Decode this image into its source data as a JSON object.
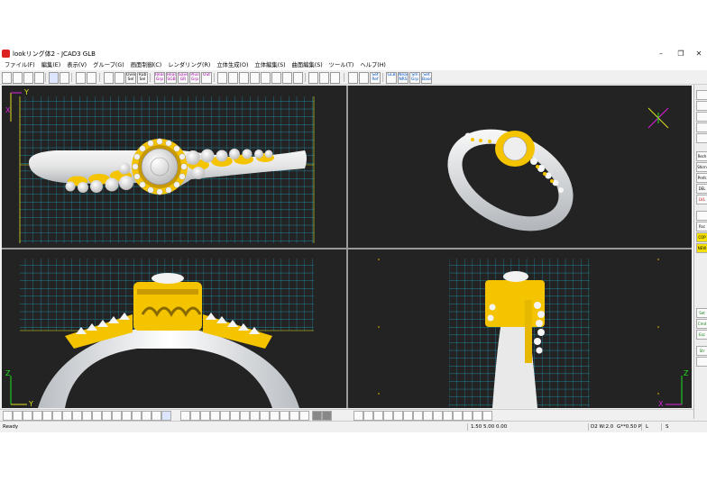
{
  "window": {
    "title": "lookリング体2 - JCAD3 GLB",
    "minimize": "–",
    "maximize": "❐",
    "close": "✕"
  },
  "menu": [
    "ファイル(F)",
    "編集(E)",
    "表示(V)",
    "グループ(G)",
    "画面制御(C)",
    "レンダリング(R)",
    "立体生成(O)",
    "立体編集(S)",
    "曲面編集(S)",
    "ツール(T)",
    "ヘルプ(H)"
  ],
  "toolbar": {
    "labels": [
      "Over Sel",
      "Rub Sel",
      "Read Grp",
      "Read SGB",
      "Save GR",
      "Plus Grp",
      "Out",
      "Set Ref",
      "GLB",
      "Near NRS",
      "Sm Grp",
      "Set Base"
    ]
  },
  "sidebar": {
    "labels": [
      "Rech",
      "Stkrn",
      "Prefs",
      "DEL",
      "LVL",
      "Rsc",
      "COP",
      "NEW",
      "Set Ref",
      "Cmd Strt",
      "Exc Spl",
      "Str Div"
    ]
  },
  "axes": {
    "top_left_vertical": "Y",
    "top_left_horizontal": "X",
    "bottom_left_vertical": "Z",
    "bottom_left_horizontal": "Y",
    "bottom_right_vertical": "Z",
    "bottom_right_horizontal": "X"
  },
  "status": {
    "ready": "Ready",
    "coords": "1.50 5.00 0.00",
    "grid": "D2 W:2.0",
    "snap": "G**0.50 P",
    "layer": "L",
    "mode": "S"
  },
  "colors": {
    "viewport_bg": "#232323",
    "grid": "#1aa7c6",
    "gold": "#f5c400",
    "metal": "#e8e8e8",
    "axis_x": "#e020e0",
    "axis_y": "#e0e020",
    "axis_z": "#20e020"
  }
}
